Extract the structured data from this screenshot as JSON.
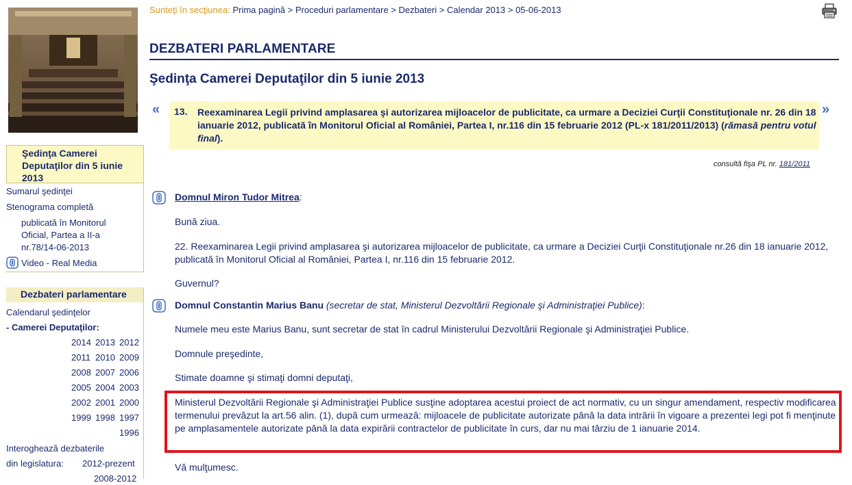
{
  "breadcrumb": {
    "prefix": "Sunteţi în secţiunea:",
    "path": "Prima pagină > Proceduri parlamentare > Dezbateri > Calendar 2013 > 05-06-2013"
  },
  "sidebar": {
    "current_session": "Şedinţa Camerei Deputaţilor din 5 iunie 2013",
    "links": {
      "summary": "Sumarul şedinţei",
      "stenogram": "Stenograma completă",
      "monitor_1": "publicată în Monitorul",
      "monitor_2": "Oficial, Partea a II-a",
      "monitor_3": "nr.78/14-06-2013",
      "video": "Video - Real Media"
    },
    "debates_header": "Dezbateri parlamentare",
    "calendar": "Calendarul şedinţelor",
    "chamber": "- Camerei Deputaţilor:",
    "years": {
      "y2014": "2014",
      "y2013": "2013",
      "y2012": "2012",
      "y2011": "2011",
      "y2010": "2010",
      "y2009": "2009",
      "y2008": "2008",
      "y2007": "2007",
      "y2006": "2006",
      "y2005": "2005",
      "y2004": "2004",
      "y2003": "2003",
      "y2002": "2002",
      "y2001": "2001",
      "y2000": "2000",
      "y1999": "1999",
      "y1998": "1998",
      "y1997": "1997",
      "y1996": "1996"
    },
    "query_1": "Interoghează dezbaterile",
    "query_2_label": "din legislatura:",
    "query_2_value": "2012-prezent",
    "query_3_value": "2008-2012"
  },
  "main": {
    "section_title": "DEZBATERI PARLAMENTARE",
    "session_title": "Şedinţa Camerei Deputaţilor din 5 iunie 2013",
    "item_number": "13.",
    "item_text": "Reexaminarea Legii privind amplasarea şi autorizarea mijloacelor de publicitate, ca urmare a Deciziei Curţii Constituţionale nr. 26 din 18 ianuarie 2012, publicată în Monitorul Oficial al României, Partea I, nr.116 din 15 februarie 2012 (PL-x 181/2011/2013)",
    "item_status": "rămasă pentru votul final",
    "item_paren_open": " (",
    "item_paren_close": ").",
    "consult_label": "consultă fişa PL nr.",
    "consult_link": "181/2011",
    "speaker_1": "Domnul Miron Tudor Mitrea",
    "colon": ":",
    "p1": "Bună ziua.",
    "p2": "22. Reexaminarea Legii privind amplasarea şi autorizarea mijloacelor de publicitate, ca urmare a Deciziei Curţii Constituţionale nr.26 din 18 ianuarie 2012, publicată în Monitorul Oficial al României, Partea I, nr.116 din 15 februarie 2012.",
    "p3": "Guvernul?",
    "speaker_2": "Domnul Constantin Marius Banu",
    "speaker_2_role": "(secretar de stat, Ministerul Dezvoltării Regionale şi Administraţiei Publice)",
    "p4": "Numele meu este Marius Banu, sunt secretar de stat în cadrul Ministerului Dezvoltării Regionale şi Administraţiei Publice.",
    "p5": "Domnule preşedinte,",
    "p6": "Stimate doamne şi stimaţi domni deputaţi,",
    "p7": "Ministerul Dezvoltării Regionale şi Administraţiei Publice susţine adoptarea acestui proiect de act normativ, cu un singur amendament, respectiv modificarea termenului prevăzut la art.56 alin. (1), după cum urmează: mijloacele de publicitate autorizate până la data intrării în vigoare a prezentei legi pot fi menţinute pe amplasamentele autorizate până la data expirării contractelor de publicitate în curs, dar nu mai târziu de 1 ianuarie 2014.",
    "p8": "Vă mulţumesc."
  },
  "icons": {
    "print": "printer-icon",
    "prev": "double-chevron-left-icon",
    "next": "double-chevron-right-icon",
    "video": "video-icon"
  },
  "colors": {
    "navy": "#1a2a6c",
    "highlight": "#fdf9c4",
    "breadcrumb_prefix": "#d59a1e",
    "annotation_red": "#e1141b"
  }
}
